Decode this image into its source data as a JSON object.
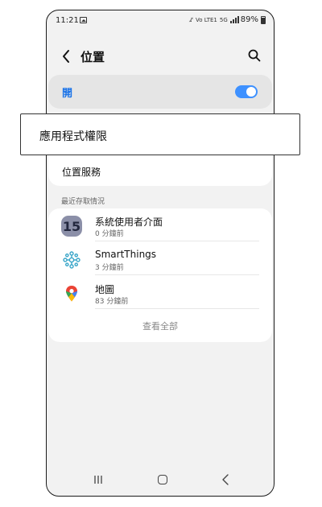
{
  "status": {
    "time": "11:21",
    "mute": "♪̸",
    "volte": "Vo LTE1",
    "network": "5G",
    "battery": "89%"
  },
  "header": {
    "title": "位置"
  },
  "toggle": {
    "label": "開",
    "state": "on",
    "accent": "#3e91ff"
  },
  "settings": {
    "app_permissions": "應用程式權限",
    "location_services": "位置服務"
  },
  "recent": {
    "section_title": "最近存取情況",
    "apps": [
      {
        "name": "系統使用者介面",
        "time": "0 分鐘前",
        "icon": "system-ui-icon"
      },
      {
        "name": "SmartThings",
        "time": "3 分鐘前",
        "icon": "smartthings-icon"
      },
      {
        "name": "地圖",
        "time": "83 分鐘前",
        "icon": "maps-icon"
      }
    ],
    "view_all": "查看全部"
  },
  "navbar": {
    "icons": [
      "recents-icon",
      "home-icon",
      "back-icon"
    ]
  }
}
